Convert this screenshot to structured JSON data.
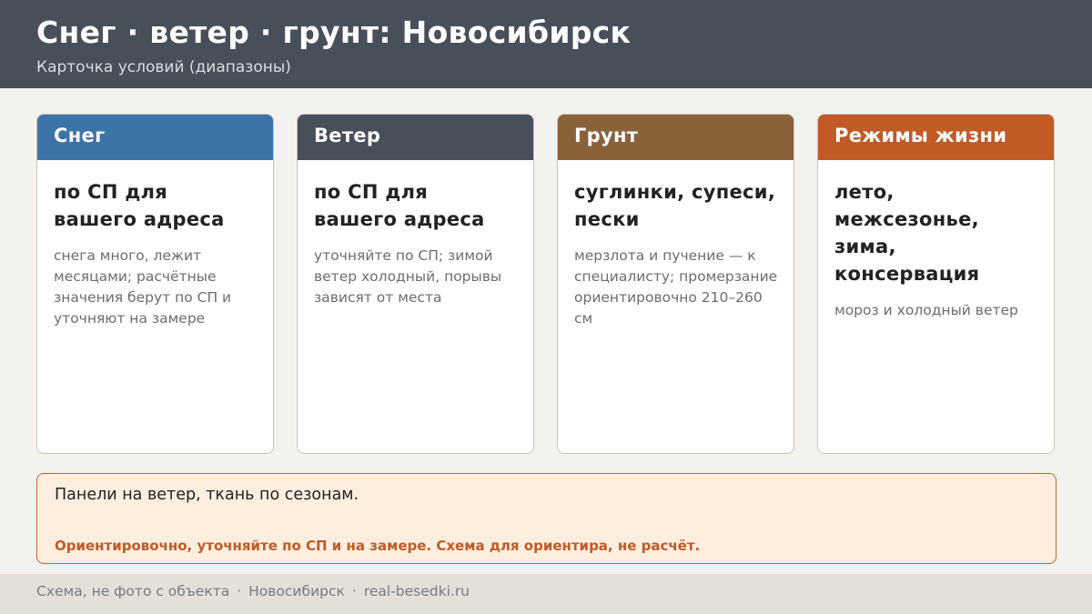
{
  "header": {
    "title": "Снег · ветер · грунт: Новосибирск",
    "subtitle": "Карточка условий (диапазоны)"
  },
  "cards": [
    {
      "heading": "Снег",
      "color": "#3d74a8",
      "main": "по СП для вашего адреса",
      "note": "снега много, лежит месяцами; расчётные значения берут по СП и уточняют на замере"
    },
    {
      "heading": "Ветер",
      "color": "#474f5b",
      "main": "по СП для вашего адреса",
      "note": "уточняйте по СП; зимой ветер холодный, порывы зависят от места"
    },
    {
      "heading": "Грунт",
      "color": "#8a623a",
      "main": "суглинки, супеси, пески",
      "note": "мерзлота и пучение — к специалисту; промерзание ориентировочно 210–260 см"
    },
    {
      "heading": "Режимы жизни",
      "color": "#c15a25",
      "main": "лето, межсезонье, зима, консервация",
      "note": "мороз и холодный ветер"
    }
  ],
  "note_box": {
    "main": "Панели на ветер, ткань по сезонам.",
    "warning": "Ориентировочно, уточняйте по СП и на замере. Схема для ориентира, не расчёт."
  },
  "footer": {
    "part1": "Схема, не фото с объекта",
    "separator": "·",
    "part2": "Новосибирск",
    "part3": "real-besedki.ru"
  }
}
